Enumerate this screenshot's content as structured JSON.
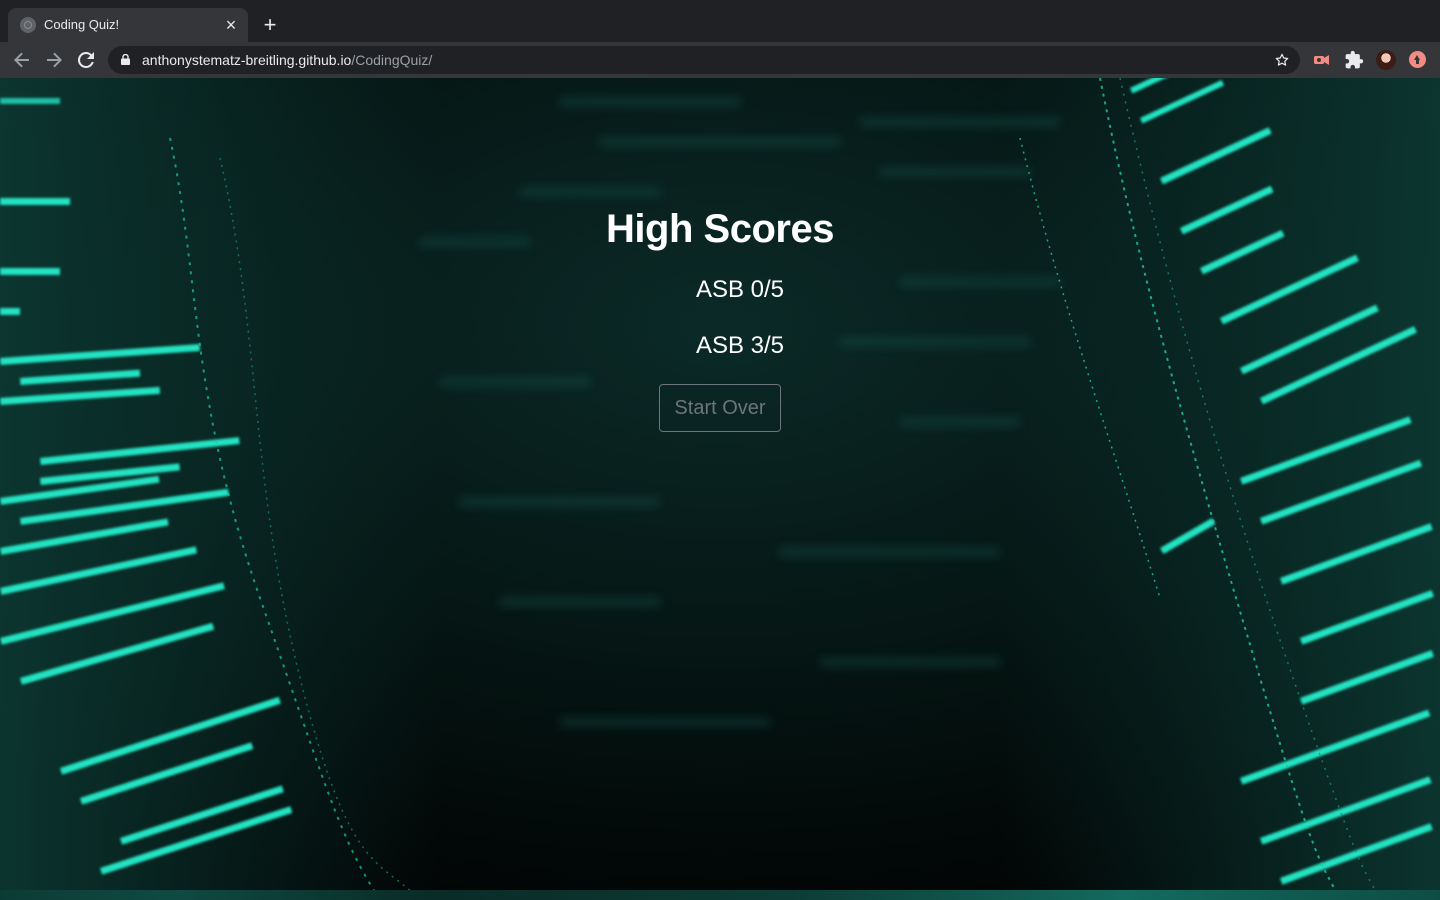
{
  "browser": {
    "tab_title": "Coding Quiz!",
    "tab_close": "×",
    "new_tab": "+",
    "url_host": "anthonystematz-breitling.github.io",
    "url_path": "/CodingQuiz/"
  },
  "page": {
    "title": "High Scores",
    "scores": [
      "ASB 0/5",
      "ASB 3/5"
    ],
    "start_over_label": "Start Over"
  },
  "colors": {
    "accent_teal": "#1de9c4",
    "button_outline": "#6c757d",
    "page_bg": "#000000"
  }
}
